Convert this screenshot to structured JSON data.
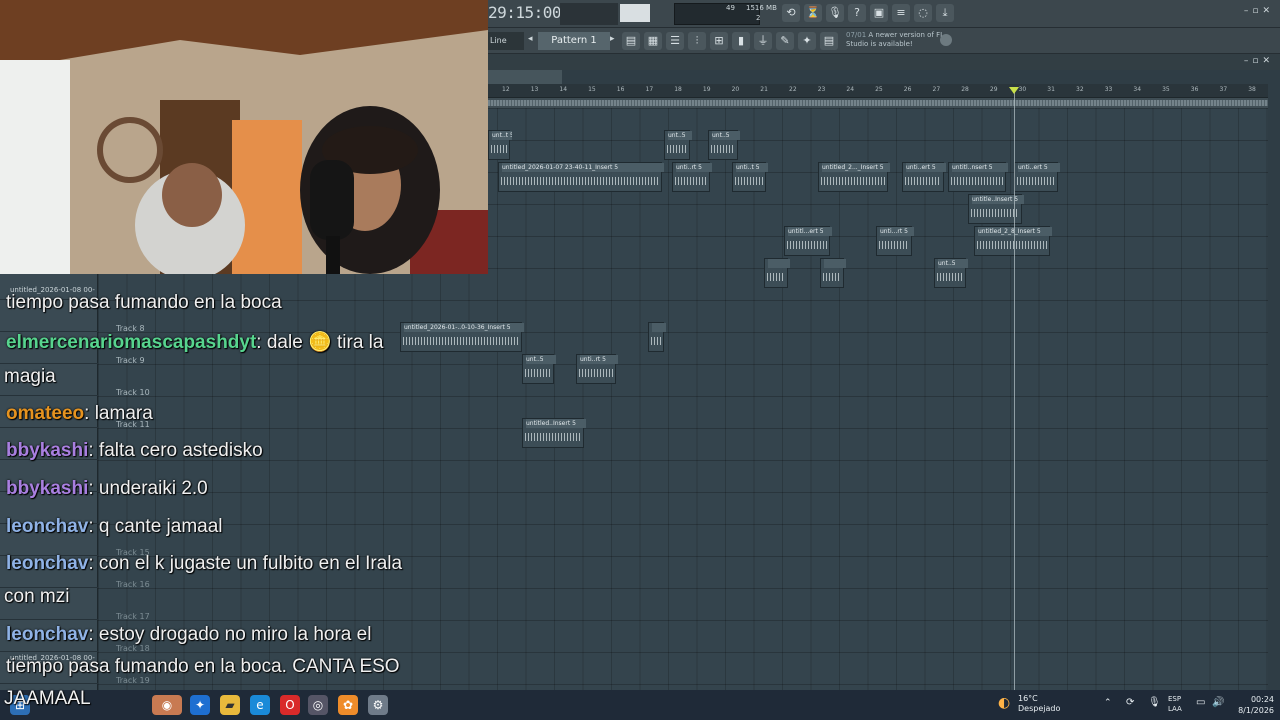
{
  "toolbar": {
    "time": "29:15:00",
    "cpu": "49",
    "memory": "1516 MB",
    "polyphony": "2",
    "pattern": "Pattern 1",
    "snap": "Line",
    "news_date": "07/01",
    "news_text": "A newer version of FL Studio is available!"
  },
  "ruler": {
    "ticks": [
      "12",
      "13",
      "14",
      "15",
      "16",
      "17",
      "18",
      "19",
      "20",
      "21",
      "22",
      "23",
      "24",
      "25",
      "26",
      "27",
      "28",
      "29",
      "30",
      "31",
      "32",
      "33",
      "34",
      "35",
      "36",
      "37",
      "38"
    ]
  },
  "tracks": {
    "t8": "Track 8",
    "t9": "Track 9",
    "t10": "Track 10",
    "t11": "Track 11",
    "t15": "Track 15",
    "t16": "Track 16",
    "t17": "Track 17",
    "t18": "Track 18",
    "t19": "Track 19"
  },
  "clips": [
    {
      "label": "unt..t 5"
    },
    {
      "label": "unt..5"
    },
    {
      "label": "unt..5"
    },
    {
      "label": "untitled_2026-01-07 23-40-11_Insert 5"
    },
    {
      "label": "unti..rt 5"
    },
    {
      "label": "unti..t 5"
    },
    {
      "label": "untitled_2..._Insert 5"
    },
    {
      "label": "unti..ert 5"
    },
    {
      "label": "untitl..nsert 5"
    },
    {
      "label": "unti..ert 5"
    },
    {
      "label": "untitle..Insert 5"
    },
    {
      "label": "untitl...ert 5"
    },
    {
      "label": "unti...rt 5"
    },
    {
      "label": "untitled_2_8_Insert 5"
    },
    {
      "label": "unt..5"
    },
    {
      "label": "unt..5"
    },
    {
      "label": "untitled_2026-01-..0-10-36_Insert 5"
    },
    {
      "label": "unt..5"
    },
    {
      "label": "unti..rt 5"
    },
    {
      "label": "untitled..Insert 5"
    }
  ],
  "chat": [
    {
      "user": "",
      "text": "tiempo pasa fumando en la boca",
      "color": "#ffffff"
    },
    {
      "user": "elmercenariomascapashdyt",
      "text": ": dale 🪙 tira la",
      "color": "#57d48e"
    },
    {
      "user": "",
      "text": "magia",
      "color": "#ffffff"
    },
    {
      "user": "omateeo",
      "text": ": lamara",
      "color": "#e6931f"
    },
    {
      "user": "bbykashi",
      "text": ": falta cero astedisko",
      "color": "#a97fe0"
    },
    {
      "user": "bbykashi",
      "text": ": underaiki 2.0",
      "color": "#a97fe0"
    },
    {
      "user": "leonchav",
      "text": ": q cante jamaal",
      "color": "#8fb2e6"
    },
    {
      "user": "leonchav",
      "text": ": con el k jugaste un fulbito en el Irala",
      "color": "#8fb2e6"
    },
    {
      "user": "",
      "text": "con mzi",
      "color": "#ffffff"
    },
    {
      "user": "leonchav",
      "text": ": estoy drogado no miro la hora el",
      "color": "#8fb2e6"
    },
    {
      "user": "",
      "text": "tiempo pasa fumando en la boca. CANTA ESO",
      "color": "#ffffff"
    },
    {
      "user": "",
      "text": "JAAMAAL",
      "color": "#ffffff"
    }
  ],
  "left_panel_items": [
    "untitled_2026-01-08 00-",
    "untitled_2026-01-08 00-"
  ],
  "taskbar": {
    "temperature": "16°C",
    "weather": "Despejado",
    "lang": "ESP",
    "lang_sub": "LAA",
    "time": "00:24",
    "date": "8/1/2026"
  }
}
